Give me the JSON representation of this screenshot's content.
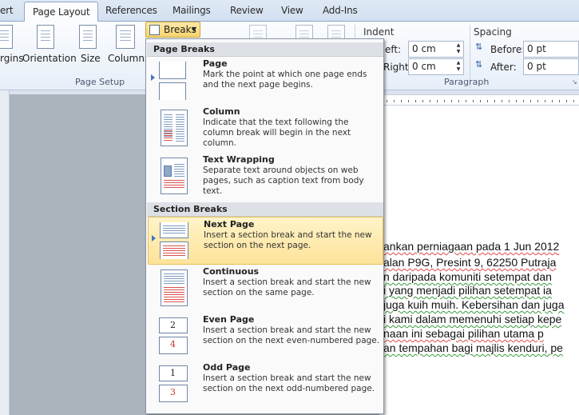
{
  "tabs": [
    "ert",
    "Page Layout",
    "References",
    "Mailings",
    "Review",
    "View",
    "Add-Ins"
  ],
  "ribbon": {
    "margins_label": "rgins",
    "orientation_label": "Orientation",
    "size_label": "Size",
    "columns_label": "Columns",
    "breaks_label": "Breaks",
    "page_setup_group": "Page Setup",
    "indent_label": "Indent",
    "left_label": "eft:",
    "left_value": "0 cm",
    "right_label": "Right:",
    "right_value": "0 cm",
    "spacing_label": "Spacing",
    "before_label": "Before:",
    "before_value": "0 pt",
    "after_label": "After:",
    "after_value": "0 pt",
    "paragraph_group": "Paragraph"
  },
  "menu": {
    "page_breaks_header": "Page Breaks",
    "section_breaks_header": "Section Breaks",
    "items": [
      {
        "title": "Page",
        "desc": "Mark the point at which one page ends and the next page begins."
      },
      {
        "title": "Column",
        "desc": "Indicate that the text following the column break will begin in the next column."
      },
      {
        "title": "Text Wrapping",
        "desc": "Separate text around objects on web pages, such as caption text from body text."
      },
      {
        "title": "Next Page",
        "desc": "Insert a section break and start the new section on the next page."
      },
      {
        "title": "Continuous",
        "desc": "Insert a section break and start the new section on the same page."
      },
      {
        "title": "Even Page",
        "desc": "Insert a section break and start the new section on the next even-numbered page."
      },
      {
        "title": "Odd Page",
        "desc": "Insert a section break and start the new section on the next odd-numbered page."
      }
    ],
    "icon_numbers": [
      "2",
      "4",
      "1",
      "3"
    ]
  },
  "document": {
    "lines": [
      "ankan perniagaan pada 1 Jun 2012",
      "alan P9G, Presint 9, 62250 Putraja",
      "n daripada komuniti setempat dan",
      "i yang menjadi pilihan setempat ia",
      "juga kuih muih. Kebersihan dan juga",
      "i kami dalam memenuhi setiap kepe",
      "naan ini sebagai pilihan utama p",
      "an tempahan bagi majlis kenduri, pe"
    ]
  },
  "colors": {
    "highlight": "#fde39a",
    "menu_header": "#dde1e6",
    "ribbon_bg": "#e6eef8"
  }
}
